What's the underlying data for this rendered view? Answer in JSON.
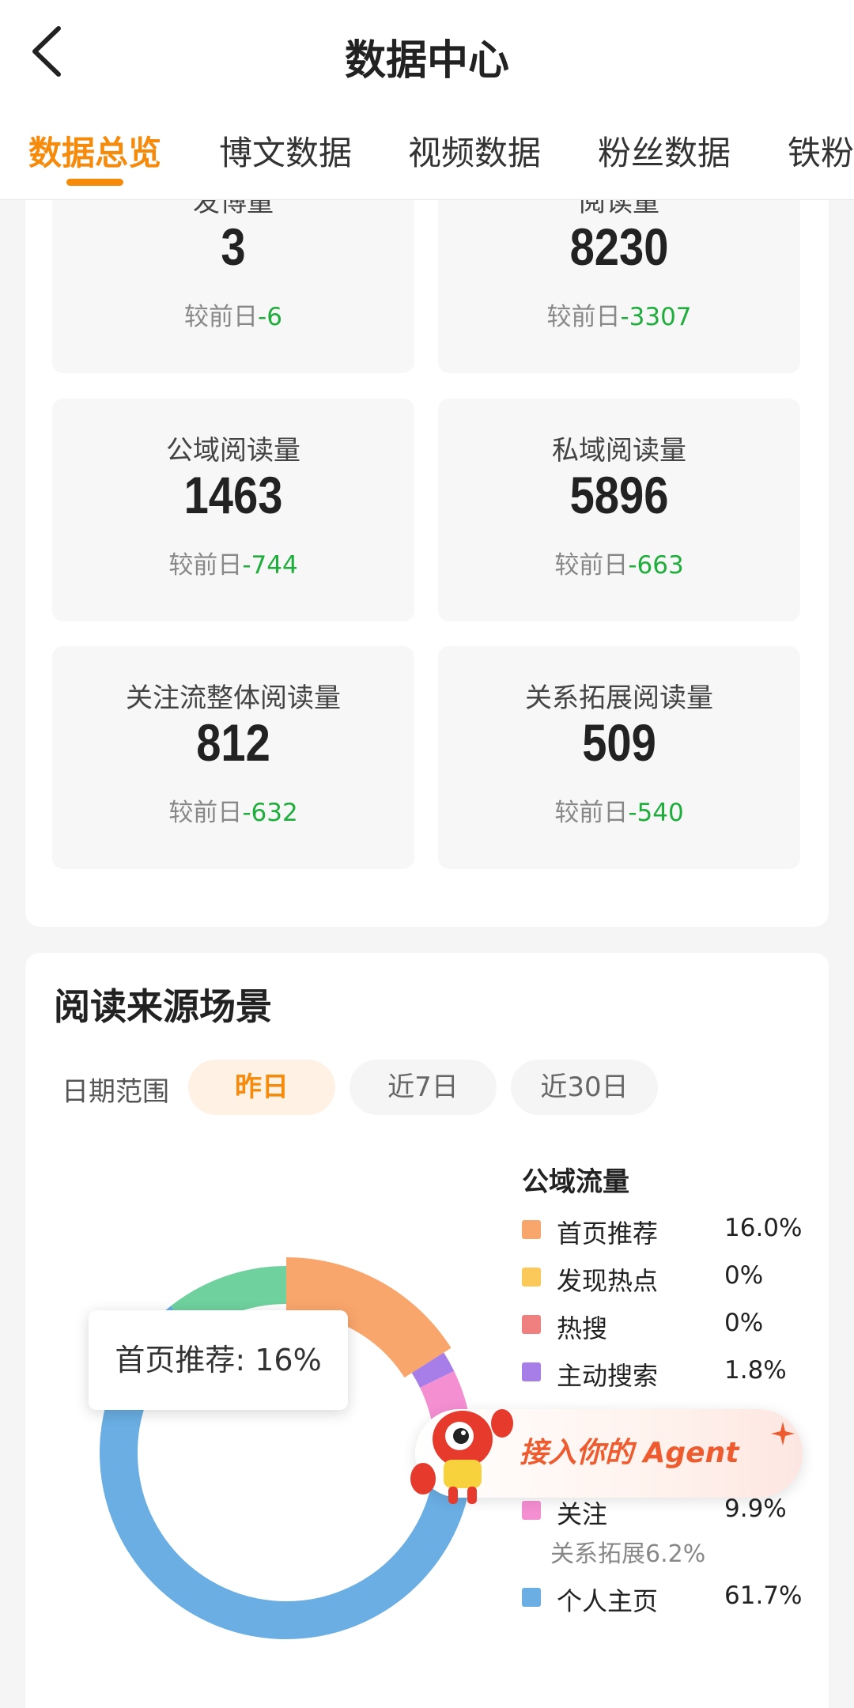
{
  "header": {
    "title": "数据中心",
    "tabs": [
      {
        "label": "数据总览",
        "active": true
      },
      {
        "label": "博文数据",
        "active": false
      },
      {
        "label": "视频数据",
        "active": false
      },
      {
        "label": "粉丝数据",
        "active": false
      },
      {
        "label": "铁粉",
        "active": false
      }
    ]
  },
  "stats": [
    {
      "label": "发博量",
      "value": "3",
      "compare_prefix": "较前日",
      "delta": "-6"
    },
    {
      "label": "阅读量",
      "value": "8230",
      "compare_prefix": "较前日",
      "delta": "-3307"
    },
    {
      "label": "公域阅读量",
      "value": "1463",
      "compare_prefix": "较前日",
      "delta": "-744"
    },
    {
      "label": "私域阅读量",
      "value": "5896",
      "compare_prefix": "较前日",
      "delta": "-663"
    },
    {
      "label": "关注流整体阅读量",
      "value": "812",
      "compare_prefix": "较前日",
      "delta": "-632"
    },
    {
      "label": "关系拓展阅读量",
      "value": "509",
      "compare_prefix": "较前日",
      "delta": "-540"
    }
  ],
  "source": {
    "title": "阅读来源场景",
    "date_label": "日期范围",
    "date_options": [
      {
        "label": "昨日",
        "active": true
      },
      {
        "label": "近7日",
        "active": false
      },
      {
        "label": "近30日",
        "active": false
      }
    ],
    "tooltip": "首页推荐: 16%",
    "legend_title": "公域流量",
    "legend": [
      {
        "name": "首页推荐",
        "pct": "16.0%",
        "color": "#f9a66c"
      },
      {
        "name": "发现热点",
        "pct": "0%",
        "color": "#fbc85a"
      },
      {
        "name": "热搜",
        "pct": "0%",
        "color": "#f08080"
      },
      {
        "name": "主动搜索",
        "pct": "1.8%",
        "color": "#a77de8"
      },
      {
        "name": "关注",
        "pct": "9.9%",
        "color": "#f48fd2"
      },
      {
        "name": "个人主页",
        "pct": "61.7%",
        "color": "#6aaee3"
      }
    ],
    "legend_sub": "关系拓展6.2%"
  },
  "chart_data": {
    "type": "pie",
    "title": "阅读来源场景",
    "slices": [
      {
        "label": "首页推荐",
        "value": 16.0,
        "color": "#f9a66c"
      },
      {
        "label": "发现热点",
        "value": 0,
        "color": "#fbc85a"
      },
      {
        "label": "热搜",
        "value": 0,
        "color": "#f08080"
      },
      {
        "label": "主动搜索",
        "value": 1.8,
        "color": "#a77de8"
      },
      {
        "label": "关注",
        "value": 9.9,
        "color": "#f48fd2"
      },
      {
        "label": "个人主页",
        "value": 61.7,
        "color": "#6aaee3"
      },
      {
        "color": "#6fd19e",
        "value": 10.6
      }
    ]
  },
  "agent_banner": {
    "text": "接入你的 Agent"
  },
  "colors": {
    "accent": "#f58a0b",
    "delta_green": "#1fae3c"
  }
}
